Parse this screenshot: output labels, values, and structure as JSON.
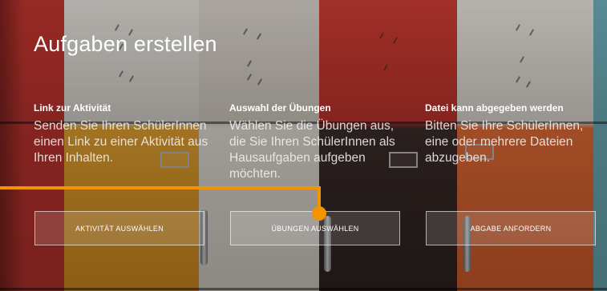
{
  "page": {
    "title": "Aufgaben erstellen"
  },
  "columns": [
    {
      "heading": "Link zur Aktivität",
      "description": "Senden Sie Ihren SchülerInnen einen Link zu einer Aktivität aus Ihren Inhalten.",
      "button_label": "Aktivität auswählen"
    },
    {
      "heading": "Auswahl der Übungen",
      "description": "Wählen Sie die Übungen aus, die Sie Ihren SchülerInnen als Hausaufgaben aufgeben möchten.",
      "button_label": "Übungen auswählen"
    },
    {
      "heading": "Datei kann abgegeben werden",
      "description": "Bitten Sie Ihre SchülerInnen, eine oder mehrere Dateien abzugeben.",
      "button_label": "Abgabe anfordern"
    }
  ],
  "colors": {
    "callout": "#f29400"
  },
  "icons": {
    "callout": "callout-pointer"
  }
}
